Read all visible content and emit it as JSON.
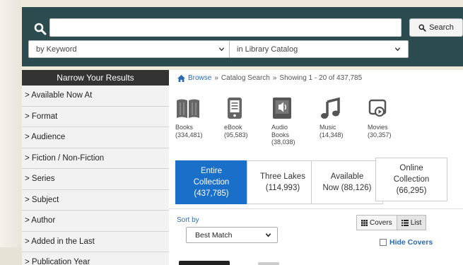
{
  "header": {
    "search_button_label": "Search",
    "search_input_value": "",
    "keyword_select": "by Keyword",
    "catalog_select": "in Library Catalog"
  },
  "sidebar": {
    "title": "Narrow Your Results",
    "items": [
      {
        "label": "> Available Now At"
      },
      {
        "label": "> Format"
      },
      {
        "label": "> Audience"
      },
      {
        "label": "> Fiction / Non-Fiction"
      },
      {
        "label": "> Series"
      },
      {
        "label": "> Subject"
      },
      {
        "label": "> Author"
      },
      {
        "label": "> Added in the Last"
      },
      {
        "label": "> Publication Year"
      }
    ]
  },
  "breadcrumb": {
    "home": "Browse",
    "sep1": "»",
    "search": "Catalog Search",
    "sep2": "»",
    "showing": "Showing 1 - 20 of 437,785"
  },
  "formats": [
    {
      "name": "Books",
      "count": "(334,481)",
      "icon": "book-icon"
    },
    {
      "name": "eBook",
      "count": "(95,583)",
      "icon": "ebook-icon"
    },
    {
      "name": "Audio Books",
      "count": "(38,038)",
      "icon": "audiobook-icon"
    },
    {
      "name": "Music",
      "count": "(14,348)",
      "icon": "music-icon"
    },
    {
      "name": "Movies",
      "count": "(30,357)",
      "icon": "movie-icon"
    }
  ],
  "tabs": [
    {
      "line1": "Entire",
      "line2": "Collection",
      "line3": "(437,785)",
      "active": true
    },
    {
      "line1": "Three Lakes",
      "line2": "(114,993)",
      "line3": "",
      "active": false
    },
    {
      "line1": "Available",
      "line2": "Now (88,126)",
      "line3": "",
      "active": false
    },
    {
      "line1": "Online",
      "line2": "Collection",
      "line3": "(66,295)",
      "active": false
    }
  ],
  "sort": {
    "label": "Sort by",
    "selected": "Best Match"
  },
  "view": {
    "covers_label": "Covers",
    "list_label": "List",
    "hide_covers_label": "Hide Covers"
  },
  "colors": {
    "header_bg": "#2c4b4e",
    "active_tab": "#1a6fc9",
    "link": "#2a6ab4"
  }
}
